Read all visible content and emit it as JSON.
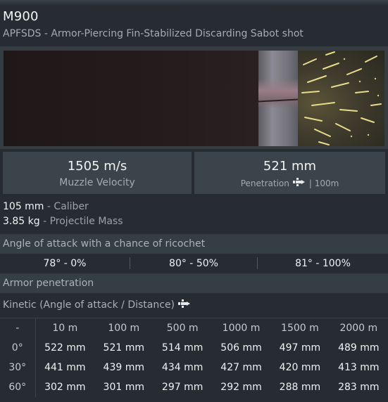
{
  "header": {
    "title": "M900",
    "subtitle": "APFSDS - Armor-Piercing Fin-Stabilized Discarding Sabot shot"
  },
  "stats": {
    "velocity_value": "1505 m/s",
    "velocity_label": "Muzzle Velocity",
    "penetration_value": "521 mm",
    "penetration_label": "Penetration",
    "penetration_distance": "| 100m"
  },
  "specs": {
    "caliber_value": "105 mm",
    "caliber_label": "Caliber",
    "mass_value": "3.85 kg",
    "mass_label": "Projectile Mass"
  },
  "ricochet": {
    "title": "Angle of attack with a chance of ricochet",
    "values": [
      "78° - 0%",
      "80° - 50%",
      "81° - 100%"
    ]
  },
  "armor": {
    "title": "Armor penetration",
    "kinetic_label": "Kinetic (Angle of attack / Distance)",
    "columns": [
      "-",
      "10 m",
      "100 m",
      "500 m",
      "1000 m",
      "1500 m",
      "2000 m"
    ],
    "rows": [
      {
        "angle": "0°",
        "values": [
          "522 mm",
          "521 mm",
          "514 mm",
          "506 mm",
          "497 mm",
          "489 mm"
        ]
      },
      {
        "angle": "30°",
        "values": [
          "441 mm",
          "439 mm",
          "434 mm",
          "427 mm",
          "420 mm",
          "413 mm"
        ]
      },
      {
        "angle": "60°",
        "values": [
          "302 mm",
          "301 mm",
          "297 mm",
          "292 mm",
          "288 mm",
          "283 mm"
        ]
      }
    ]
  },
  "icons": {
    "shell_icon": "projectile-icon",
    "kinetic_icon": "projectile-icon"
  }
}
